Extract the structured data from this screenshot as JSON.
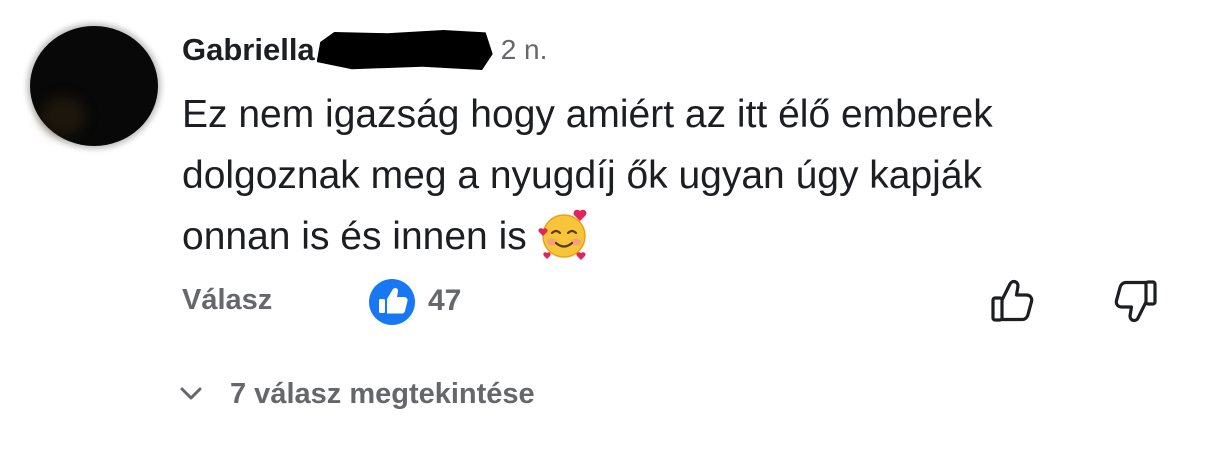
{
  "comment": {
    "author_name": "Gabriella",
    "timestamp": "2 n.",
    "text": "Ez nem igazság hogy amiért az itt élő emberek\ndolgoznak meg a nyugdíj ők ugyan úgy kapják\nonnan is és innen is",
    "emoji": "smiling-face-with-hearts"
  },
  "actions": {
    "reply_label": "Válasz",
    "like_count": "47",
    "like_icon": "thumbs-up-icon",
    "upvote_icon": "thumb-up-outline-icon",
    "downvote_icon": "thumb-down-outline-icon"
  },
  "replies": {
    "view_label": "7 válasz megtekintése",
    "chevron_icon": "chevron-down-icon"
  },
  "colors": {
    "text_primary": "#1c1e21",
    "text_secondary": "#65676b",
    "like_blue": "#1877f2"
  }
}
